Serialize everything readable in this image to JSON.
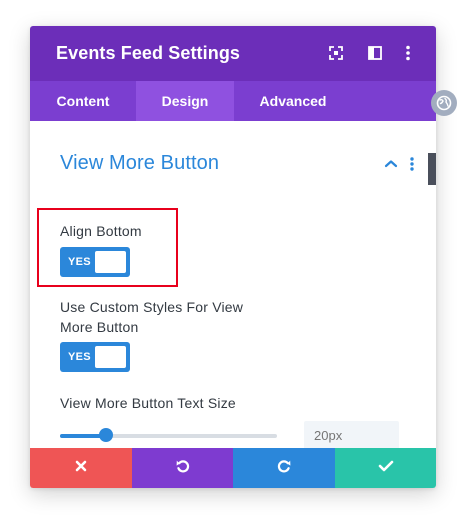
{
  "modal": {
    "title": "Events Feed Settings",
    "header_icons": [
      "expand-icon",
      "sidebar-layout-icon",
      "kebab-menu-icon"
    ],
    "tabs": [
      {
        "label": "Content",
        "active": false
      },
      {
        "label": "Design",
        "active": true
      },
      {
        "label": "Advanced",
        "active": false
      }
    ]
  },
  "section": {
    "title": "View More Button",
    "collapse_icon": "chevron-up-icon",
    "menu_icon": "kebab-menu-icon"
  },
  "fields": {
    "align_bottom": {
      "label": "Align Bottom",
      "value": "YES"
    },
    "custom_styles": {
      "label_line1": "Use Custom Styles For View",
      "label_line2": "More Button",
      "value": "YES"
    },
    "text_size": {
      "label": "View More Button Text Size",
      "value": "",
      "placeholder": "20px",
      "slider_fraction": 0.21
    }
  },
  "footer": {
    "buttons": [
      {
        "name": "cancel",
        "icon": "close-icon",
        "color": "#ef5555"
      },
      {
        "name": "undo",
        "icon": "undo-icon",
        "color": "#7e3bd0"
      },
      {
        "name": "redo",
        "icon": "redo-icon",
        "color": "#2b87da"
      },
      {
        "name": "save",
        "icon": "check-icon",
        "color": "#29c4a9"
      }
    ]
  },
  "colors": {
    "header": "#6c2eb9",
    "tabs_bar": "#7b3ed0",
    "tab_active": "#8f51e0",
    "accent": "#2b87da",
    "highlight": "#e8001c"
  }
}
